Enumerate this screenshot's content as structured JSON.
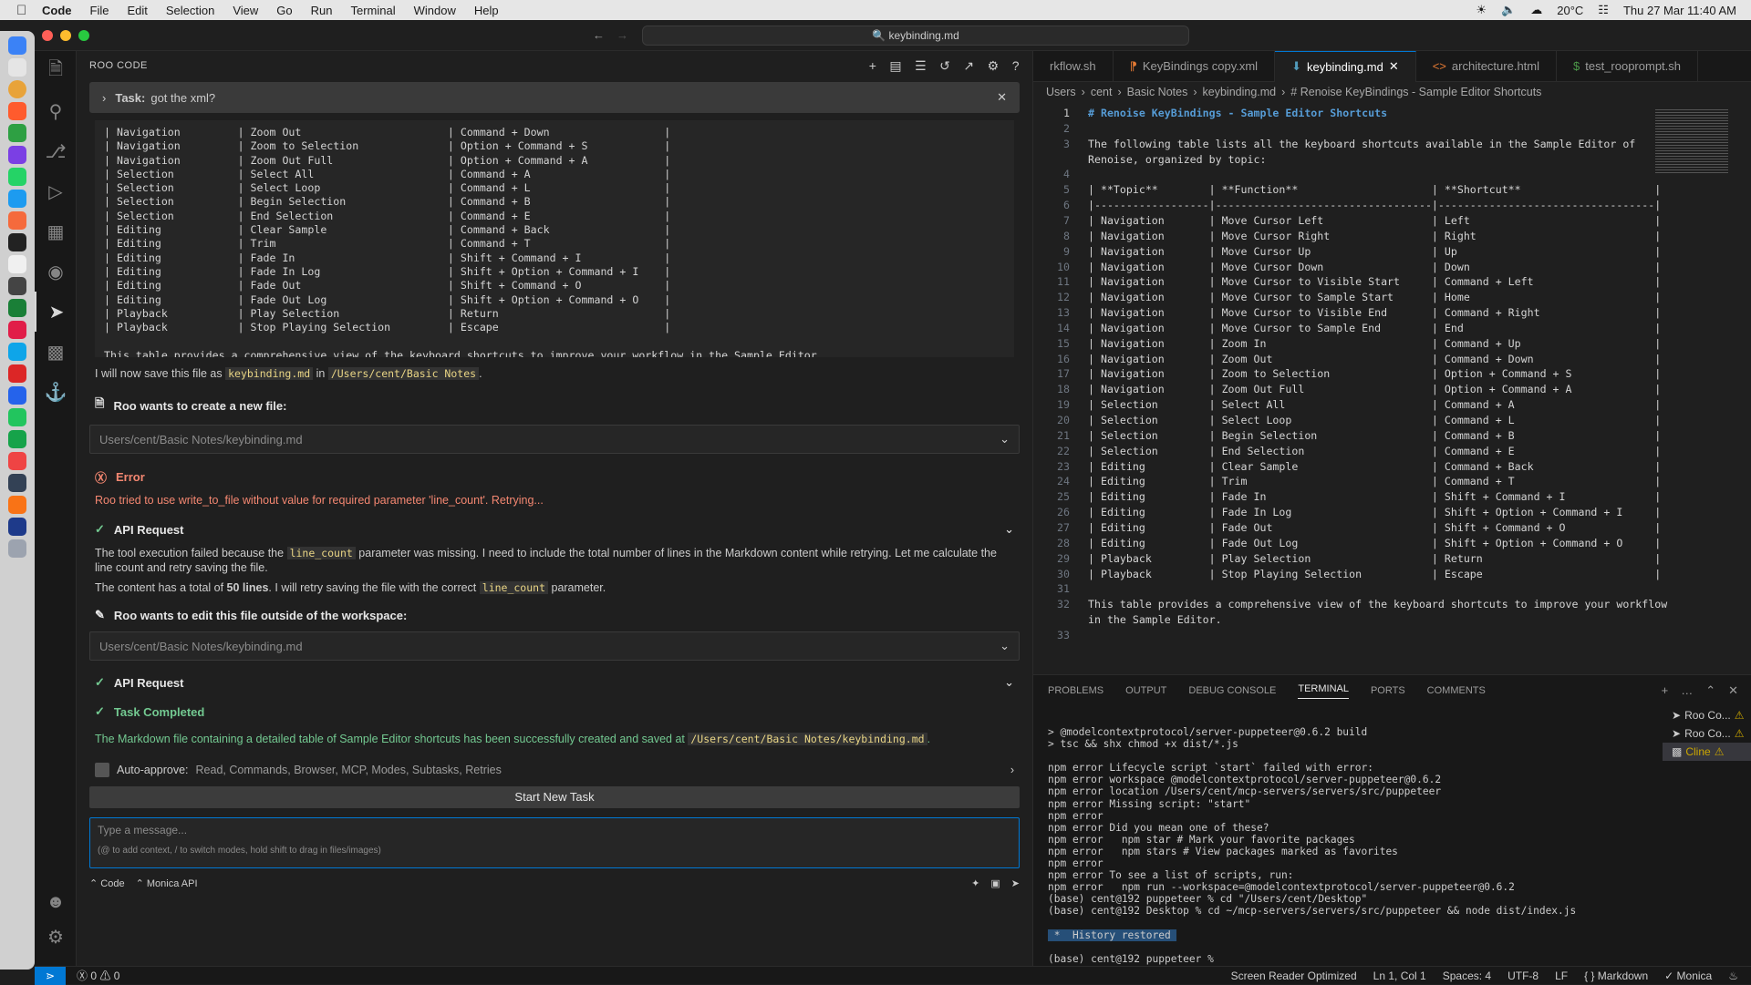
{
  "menubar": {
    "app": "Code",
    "items": [
      "File",
      "Edit",
      "Selection",
      "View",
      "Go",
      "Run",
      "Terminal",
      "Window",
      "Help"
    ],
    "weather": "20°C",
    "datetime": "Thu 27 Mar  11:40 AM"
  },
  "window": {
    "command_center": "keybinding.md"
  },
  "roo": {
    "header": "ROO CODE",
    "task_label": "Task:",
    "task_text": "got the xml?",
    "table_lines": [
      "| Navigation         | Zoom Out                       | Command + Down                  |",
      "| Navigation         | Zoom to Selection              | Option + Command + S            |",
      "| Navigation         | Zoom Out Full                  | Option + Command + A            |",
      "| Selection          | Select All                     | Command + A                     |",
      "| Selection          | Select Loop                    | Command + L                     |",
      "| Selection          | Begin Selection                | Command + B                     |",
      "| Selection          | End Selection                  | Command + E                     |",
      "| Editing            | Clear Sample                   | Command + Back                  |",
      "| Editing            | Trim                           | Command + T                     |",
      "| Editing            | Fade In                        | Shift + Command + I             |",
      "| Editing            | Fade In Log                    | Shift + Option + Command + I    |",
      "| Editing            | Fade Out                       | Shift + Command + O             |",
      "| Editing            | Fade Out Log                   | Shift + Option + Command + O    |",
      "| Playback           | Play Selection                 | Return                          |",
      "| Playback           | Stop Playing Selection         | Escape                          |",
      "",
      "This table provides a comprehensive view of the keyboard shortcuts to improve your workflow in the Sample Editor."
    ],
    "save_pre": "I will now save this file as ",
    "save_file": "keybinding.md",
    "save_mid": " in ",
    "save_path": "/Users/cent/Basic Notes",
    "save_post": ".",
    "create_head": "Roo wants to create a new file:",
    "create_path": "Users/cent/Basic Notes/keybinding.md",
    "error_head": "Error",
    "error_text": "Roo tried to use write_to_file without value for required parameter 'line_count'. Retrying...",
    "api1": "API Request",
    "expl_pre": "The tool execution failed because the ",
    "expl_code": "line_count",
    "expl_post": " parameter was missing. I need to include the total number of lines in the Markdown content while retrying. Let me calculate the line count and retry saving the file.",
    "content_pre": "The content has a total of ",
    "content_bold": "50 lines",
    "content_mid": ". I will retry saving the file with the correct ",
    "content_code": "line_count",
    "content_post": " parameter.",
    "edit_head": "Roo wants to edit this file outside of the workspace:",
    "edit_path": "Users/cent/Basic Notes/keybinding.md",
    "api2": "API Request",
    "done_head": "Task Completed",
    "done_pre": "The Markdown file containing a detailed table of Sample Editor shortcuts has been successfully created and saved at ",
    "done_path": "/Users/cent/Basic Notes/keybinding.md",
    "done_post": ".",
    "auto_label": "Auto-approve:",
    "auto_list": "Read, Commands, Browser, MCP, Modes, Subtasks, Retries",
    "start_btn": "Start New Task",
    "input_placeholder": "Type a message...",
    "input_hint": "(@ to add context, / to switch modes, hold shift to drag in files/images)",
    "mode": "Code",
    "provider": "Monica API"
  },
  "editor": {
    "tabs": [
      "rkflow.sh",
      "KeyBindings copy.xml",
      "keybinding.md",
      "architecture.html",
      "test_rooprompt.sh"
    ],
    "crumbs": [
      "Users",
      "cent",
      "Basic Notes",
      "keybinding.md",
      "# Renoise KeyBindings - Sample Editor Shortcuts"
    ],
    "lines": [
      "# Renoise KeyBindings - Sample Editor Shortcuts",
      "",
      "The following table lists all the keyboard shortcuts available in the Sample Editor of",
      "Renoise, organized by topic:",
      "",
      "| **Topic**        | **Function**                     | **Shortcut**                     |",
      "|------------------|----------------------------------|----------------------------------|",
      "| Navigation       | Move Cursor Left                 | Left                             |",
      "| Navigation       | Move Cursor Right                | Right                            |",
      "| Navigation       | Move Cursor Up                   | Up                               |",
      "| Navigation       | Move Cursor Down                 | Down                             |",
      "| Navigation       | Move Cursor to Visible Start     | Command + Left                   |",
      "| Navigation       | Move Cursor to Sample Start      | Home                             |",
      "| Navigation       | Move Cursor to Visible End       | Command + Right                  |",
      "| Navigation       | Move Cursor to Sample End        | End                              |",
      "| Navigation       | Zoom In                          | Command + Up                     |",
      "| Navigation       | Zoom Out                         | Command + Down                   |",
      "| Navigation       | Zoom to Selection                | Option + Command + S             |",
      "| Navigation       | Zoom Out Full                    | Option + Command + A             |",
      "| Selection        | Select All                       | Command + A                      |",
      "| Selection        | Select Loop                      | Command + L                      |",
      "| Selection        | Begin Selection                  | Command + B                      |",
      "| Selection        | End Selection                    | Command + E                      |",
      "| Editing          | Clear Sample                     | Command + Back                   |",
      "| Editing          | Trim                             | Command + T                      |",
      "| Editing          | Fade In                          | Shift + Command + I              |",
      "| Editing          | Fade In Log                      | Shift + Option + Command + I     |",
      "| Editing          | Fade Out                         | Shift + Command + O              |",
      "| Editing          | Fade Out Log                     | Shift + Option + Command + O     |",
      "| Playback         | Play Selection                   | Return                           |",
      "| Playback         | Stop Playing Selection           | Escape                           |",
      "",
      "This table provides a comprehensive view of the keyboard shortcuts to improve your workflow",
      "in the Sample Editor.",
      ""
    ],
    "line_numbers": [
      "1",
      "2",
      "3",
      "",
      "4",
      "5",
      "6",
      "7",
      "8",
      "9",
      "10",
      "11",
      "12",
      "13",
      "14",
      "15",
      "16",
      "17",
      "18",
      "19",
      "20",
      "21",
      "22",
      "23",
      "24",
      "25",
      "26",
      "27",
      "28",
      "29",
      "30",
      "31",
      "32",
      "",
      "33"
    ]
  },
  "panel": {
    "tabs": [
      "PROBLEMS",
      "OUTPUT",
      "DEBUG CONSOLE",
      "TERMINAL",
      "PORTS",
      "COMMENTS"
    ],
    "terminal": [
      "> @modelcontextprotocol/server-puppeteer@0.6.2 build",
      "> tsc && shx chmod +x dist/*.js",
      "",
      "npm error Lifecycle script `start` failed with error:",
      "npm error workspace @modelcontextprotocol/server-puppeteer@0.6.2",
      "npm error location /Users/cent/mcp-servers/servers/src/puppeteer",
      "npm error Missing script: \"start\"",
      "npm error",
      "npm error Did you mean one of these?",
      "npm error   npm star # Mark your favorite packages",
      "npm error   npm stars # View packages marked as favorites",
      "npm error",
      "npm error To see a list of scripts, run:",
      "npm error   npm run --workspace=@modelcontextprotocol/server-puppeteer@0.6.2",
      "(base) cent@192 puppeteer % cd \"/Users/cent/Desktop\"",
      "(base) cent@192 Desktop % cd ~/mcp-servers/servers/src/puppeteer && node dist/index.js",
      "",
      " *  History restored ",
      "",
      "(base) cent@192 puppeteer % "
    ],
    "term_list": [
      "Roo Co...",
      "Roo Co...",
      "Cline"
    ]
  },
  "status": {
    "problems": "0",
    "warnings": "0",
    "items": [
      "Screen Reader Optimized",
      "Ln 1, Col 1",
      "Spaces: 4",
      "UTF-8",
      "LF",
      "{ } Markdown",
      "Monica"
    ]
  }
}
